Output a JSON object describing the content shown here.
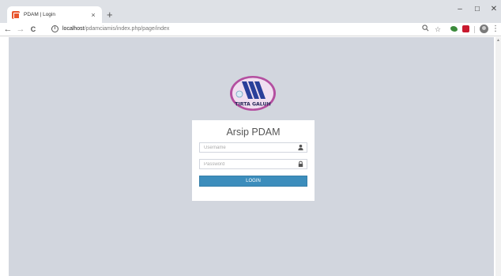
{
  "browser": {
    "tab_title": "PDAM | Login",
    "tab_close": "×",
    "new_tab": "+",
    "window_minimize": "–",
    "window_maximize": "☐",
    "window_close": "✕",
    "nav_back": "←",
    "nav_forward": "→",
    "nav_reload": "C",
    "url_host": "localhost",
    "url_path": "/pdamciamis/index.php/page/index",
    "zoom_icon": "search-icon",
    "bookmark_icon": "star-icon",
    "menu_icon": "⋮"
  },
  "logo": {
    "text": "TIRTA GALUH",
    "colors": {
      "ring": "#b44fa0",
      "inner": "#f0dff0",
      "stripes": "#2a3f9a"
    }
  },
  "login": {
    "title": "Arsip PDAM",
    "username_placeholder": "Username",
    "password_placeholder": "Password",
    "button_label": "LOGIN"
  },
  "colors": {
    "page_background": "#d2d6de",
    "box_background": "#ffffff",
    "button": "#3c8dbc"
  }
}
